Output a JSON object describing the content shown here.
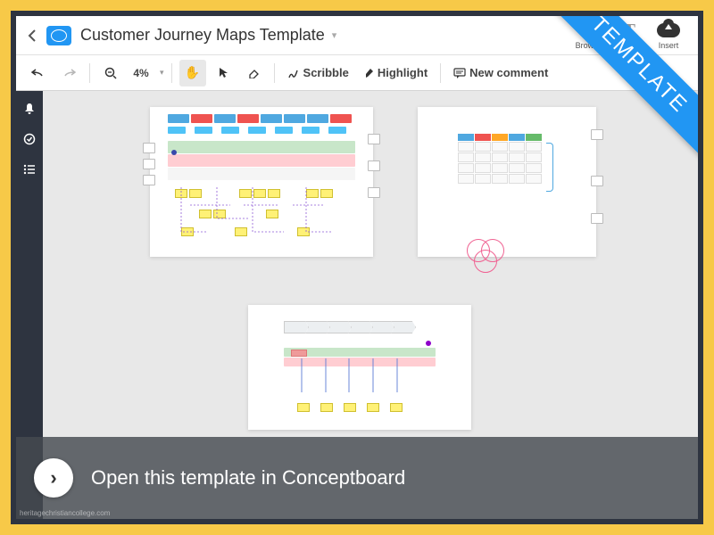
{
  "header": {
    "title": "Customer Journey Maps Template",
    "actions": {
      "browse": {
        "label": "Browse",
        "icon": "hand-icon"
      },
      "text": {
        "label": "T",
        "icon": "text-icon"
      },
      "insert": {
        "label": "Insert",
        "icon": "cloud-upload-icon"
      }
    }
  },
  "toolbar": {
    "zoom_level": "4%",
    "scribble_label": "Scribble",
    "highlight_label": "Highlight",
    "new_comment_label": "New comment"
  },
  "sidebar": {
    "items": [
      "notifications-icon",
      "approvals-icon",
      "outline-icon"
    ]
  },
  "ribbon": {
    "text": "TEMPLATE"
  },
  "overlay": {
    "text": "Open this template in Conceptboard"
  },
  "watermark": "heritagechristiancollege.com",
  "colors": {
    "accent": "#2196f3",
    "frame_outer": "#f7c948",
    "frame_inner": "#2e3440",
    "chip_red": "#ef5350",
    "chip_blue": "#4fa8e0",
    "chip_orange": "#ffa726",
    "band_green": "#c8e6c9",
    "band_pink": "#ffcdd2",
    "band_blue": "#bbdefb",
    "yellow_note": "#fff176",
    "venn": "#f06292"
  }
}
